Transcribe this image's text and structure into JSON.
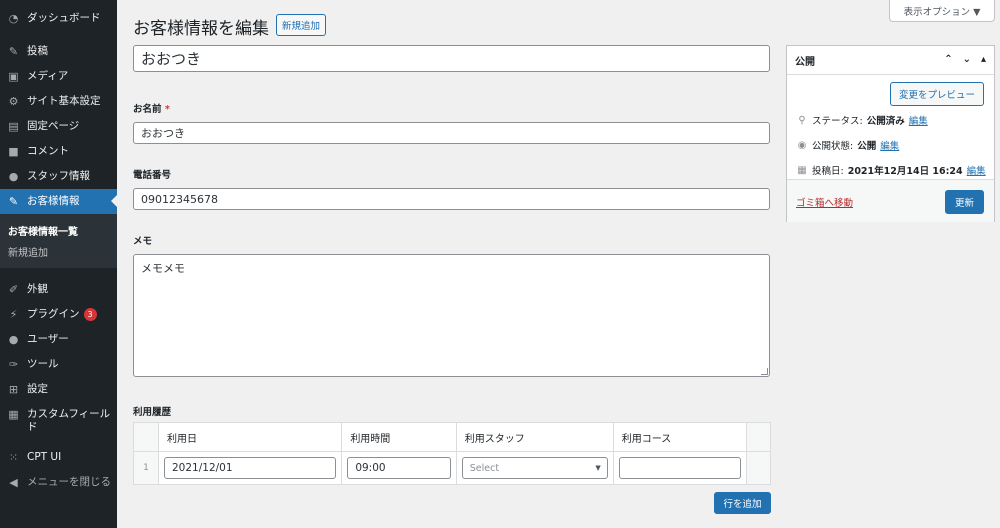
{
  "sidebar": {
    "items": [
      {
        "label": "ダッシュボード",
        "icon": "dashboard-icon"
      },
      {
        "label": "投稿",
        "icon": "pin-icon"
      },
      {
        "label": "メディア",
        "icon": "media-icon"
      },
      {
        "label": "サイト基本設定",
        "icon": "gear-icon"
      },
      {
        "label": "固定ページ",
        "icon": "page-icon"
      },
      {
        "label": "コメント",
        "icon": "comment-icon"
      },
      {
        "label": "スタッフ情報",
        "icon": "user-icon"
      },
      {
        "label": "お客様情報",
        "icon": "pin-icon"
      },
      {
        "label": "外観",
        "icon": "brush-icon"
      },
      {
        "label": "プラグイン",
        "icon": "plugin-icon",
        "badge": "3"
      },
      {
        "label": "ユーザー",
        "icon": "user-icon"
      },
      {
        "label": "ツール",
        "icon": "wrench-icon"
      },
      {
        "label": "設定",
        "icon": "settings-icon"
      },
      {
        "label": "カスタムフィールド",
        "icon": "grid-icon"
      },
      {
        "label": "CPT UI",
        "icon": "cpt-icon"
      },
      {
        "label": "メニューを閉じる",
        "icon": "collapse-icon"
      }
    ],
    "submenu": [
      "お客様情報一覧",
      "新規追加"
    ]
  },
  "header": {
    "title": "お客様情報を編集",
    "add_new": "新規追加",
    "screen_options": "表示オプション ▼"
  },
  "form": {
    "title_value": "おおつき",
    "name_label": "お名前",
    "name_required": "*",
    "name_value": "おおつき",
    "phone_label": "電話番号",
    "phone_value": "09012345678",
    "memo_label": "メモ",
    "memo_value": "メモメモ",
    "history_label": "利用履歴",
    "history_columns": [
      "利用日",
      "利用時間",
      "利用スタッフ",
      "利用コース"
    ],
    "history_rows": [
      {
        "num": "1",
        "date": "2021/12/01",
        "time": "09:00",
        "staff_placeholder": "Select",
        "course": ""
      }
    ],
    "add_row": "行を追加"
  },
  "publish": {
    "title": "公開",
    "preview": "変更をプレビュー",
    "status_label": "ステータス:",
    "status_value": "公開済み",
    "visibility_label": "公開状態:",
    "visibility_value": "公開",
    "date_label": "投稿日:",
    "date_value": "2021年12月14日 16:24",
    "edit": "編集",
    "trash": "ゴミ箱へ移動",
    "update": "更新"
  },
  "colors": {
    "accent": "#2271b1",
    "sidebar": "#1d2327",
    "danger": "#d63638"
  }
}
